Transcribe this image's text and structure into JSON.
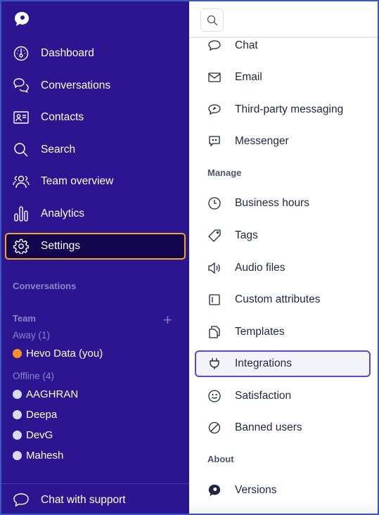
{
  "sidebar": {
    "nav": [
      {
        "label": "Dashboard",
        "icon": "dashboard-icon"
      },
      {
        "label": "Conversations",
        "icon": "conversations-icon"
      },
      {
        "label": "Contacts",
        "icon": "contacts-icon"
      },
      {
        "label": "Search",
        "icon": "search-icon"
      },
      {
        "label": "Team overview",
        "icon": "team-icon"
      },
      {
        "label": "Analytics",
        "icon": "analytics-icon"
      },
      {
        "label": "Settings",
        "icon": "gear-icon",
        "active": true
      }
    ],
    "conversations_label": "Conversations",
    "team_label": "Team",
    "away_label": "Away (1)",
    "offline_label": "Offline (4)",
    "away_members": [
      {
        "name": "Hevo Data (you)",
        "status_color": "#f7931e"
      }
    ],
    "offline_members": [
      {
        "name": "AAGHRAN"
      },
      {
        "name": "Deepa"
      },
      {
        "name": "DevG"
      },
      {
        "name": "Mahesh"
      }
    ],
    "support_label": "Chat with support",
    "colors": {
      "background": "#2b1591",
      "active_border": "#f5a623",
      "away": "#f7931e",
      "offline": "#d8dcea"
    }
  },
  "settings_menu": {
    "channels": [
      "Chat",
      "Email",
      "Third-party messaging",
      "Messenger"
    ],
    "manage_label": "Manage",
    "manage": [
      "Business hours",
      "Tags",
      "Audio files",
      "Custom attributes",
      "Templates",
      "Integrations",
      "Satisfaction",
      "Banned users"
    ],
    "active_item": "Integrations",
    "about_label": "About",
    "about": [
      "Versions"
    ],
    "colors": {
      "active_border": "#5b45ea"
    }
  }
}
